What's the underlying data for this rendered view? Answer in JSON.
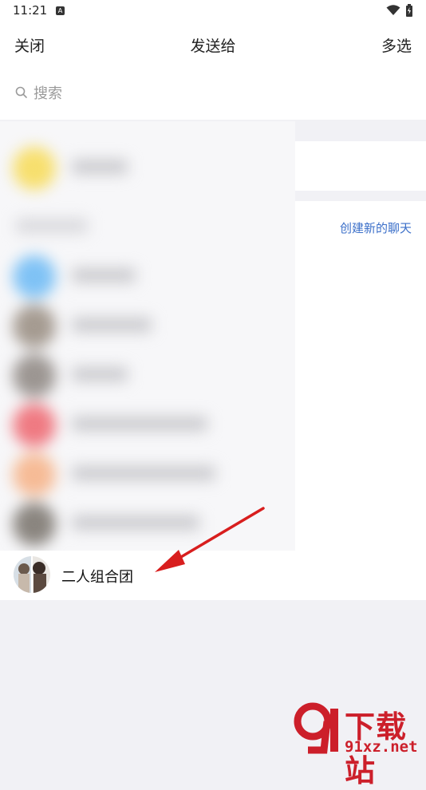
{
  "status": {
    "time": "11:21"
  },
  "header": {
    "close_label": "关闭",
    "title": "发送给",
    "multi_select_label": "多选"
  },
  "search": {
    "placeholder": "搜索"
  },
  "recent": {
    "create_chat_label": "创建新的聊天"
  },
  "contact": {
    "name": "二人组合团"
  },
  "watermark": {
    "brand": "下载站",
    "url": "91xz.net"
  },
  "colors": {
    "link": "#3b6fc9",
    "annotation_arrow": "#d81e1e",
    "background": "#f1f1f5"
  },
  "icons": {
    "search": "search-icon",
    "wifi": "wifi-icon",
    "battery": "battery-icon"
  }
}
